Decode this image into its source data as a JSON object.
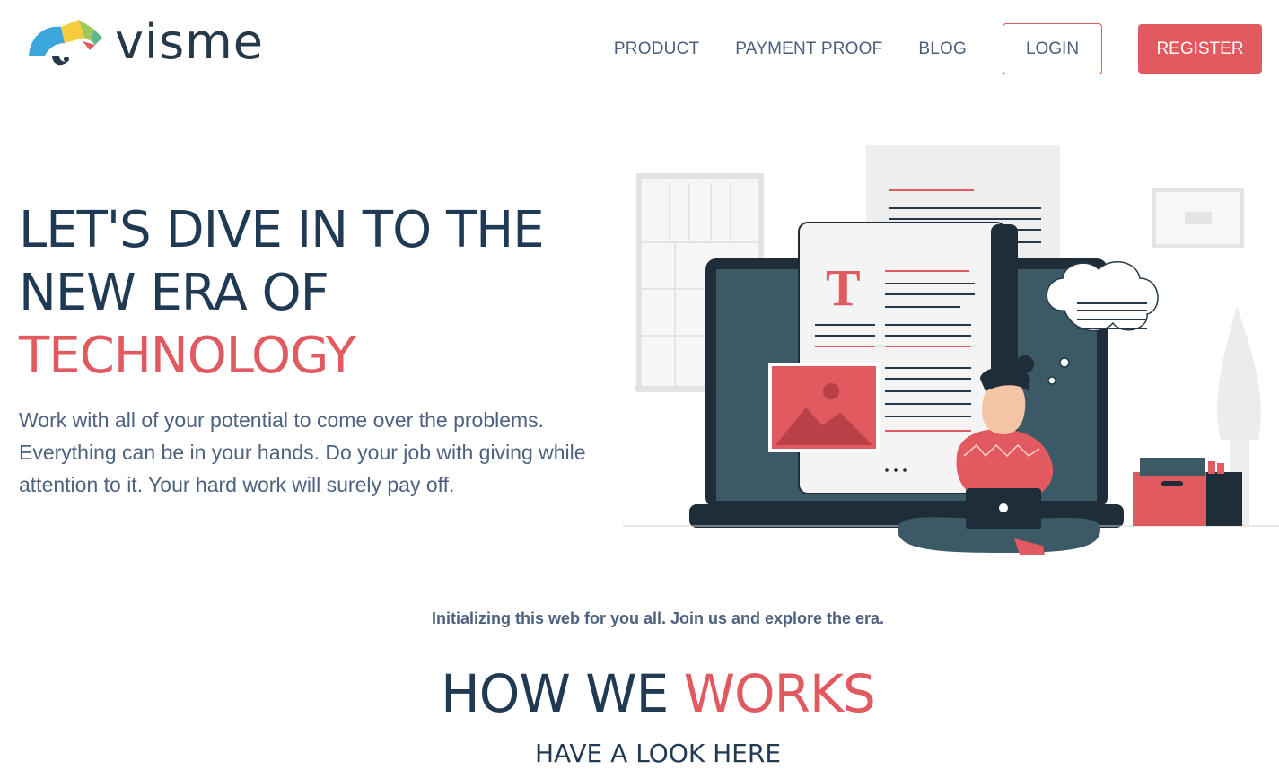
{
  "brand": {
    "name": "visme",
    "logo_colors": [
      "#3aa6dc",
      "#f5cc3c",
      "#7dc36e",
      "#e05a5f",
      "#25394a"
    ]
  },
  "nav": {
    "items": [
      {
        "label": "PRODUCT"
      },
      {
        "label": "PAYMENT PROOF"
      },
      {
        "label": "BLOG"
      }
    ],
    "login_label": "LOGIN",
    "register_label": "REGISTER"
  },
  "hero": {
    "title_line1": "LET'S DIVE IN TO THE",
    "title_line2": "NEW ERA OF",
    "title_accent": "TECHNOLOGY",
    "description": "Work with all of your potential to come over the problems. Everything can be in your hands. Do your job with giving while attention to it. Your hard work will surely pay off.",
    "illustration_text": "T"
  },
  "section": {
    "tagline": "Initializing this web for you all. Join us and explore the era.",
    "title_main": "HOW WE ",
    "title_accent": "WORKS",
    "subtitle": "HAVE A LOOK HERE"
  },
  "colors": {
    "primary": "#1f3a52",
    "accent": "#e05a5f",
    "body_text": "#4e6280"
  },
  "icons": [
    "visme-logo-icon",
    "laptop-illustration"
  ]
}
